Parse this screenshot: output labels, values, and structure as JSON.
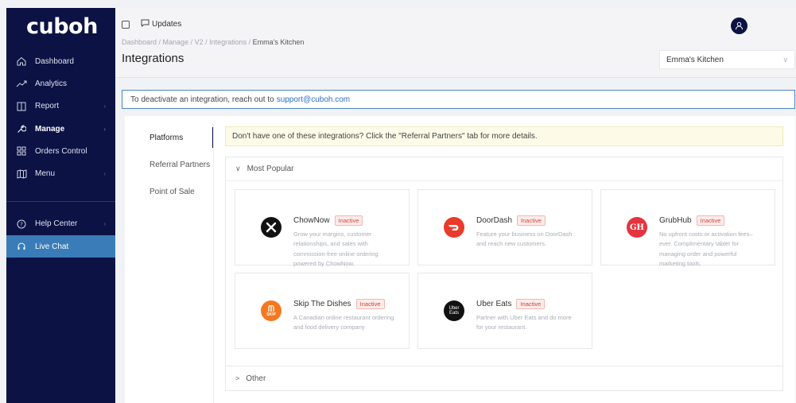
{
  "sidebar": {
    "logo": "cuboh",
    "items": [
      {
        "label": "Dashboard",
        "icon": "home-icon",
        "chevron": false
      },
      {
        "label": "Analytics",
        "icon": "trend-icon",
        "chevron": false
      },
      {
        "label": "Report",
        "icon": "report-icon",
        "chevron": true
      },
      {
        "label": "Manage",
        "icon": "wrench-icon",
        "chevron": true
      },
      {
        "label": "Orders Control",
        "icon": "grid-icon",
        "chevron": false
      },
      {
        "label": "Menu",
        "icon": "map-icon",
        "chevron": true
      }
    ],
    "help_label": "Help Center",
    "live_chat_label": "Live Chat"
  },
  "header": {
    "updates_label": "Updates",
    "breadcrumb": [
      "Dashboard",
      "Manage",
      "V2",
      "Integrations"
    ],
    "breadcrumb_current": "Emma's Kitchen",
    "title": "Integrations",
    "location_select": "Emma's Kitchen"
  },
  "notice": {
    "text": "To deactivate an integration, reach out to",
    "email": "support@cuboh.com"
  },
  "tabs": [
    "Platforms",
    "Referral Partners",
    "Point of Sale"
  ],
  "referral_notice": "Don't have one of these integrations? Click the \"Referral Partners\" tab for more details.",
  "groups": {
    "popular_label": "Most Popular",
    "other_label": "Other"
  },
  "integrations": [
    {
      "name": "ChowNow",
      "status": "Inactive",
      "desc": "Grow your margins, customer relationships, and sales with commission-free online ordering powered by ChowNow.",
      "color": "#111111"
    },
    {
      "name": "DoorDash",
      "status": "Inactive",
      "desc": "Feature your business on DoorDash and reach new customers.",
      "color": "#ea3a2a"
    },
    {
      "name": "GrubHub",
      "status": "Inactive",
      "desc": "No upfront costs or activation fees–ever. Complimentary tablet for managing order and powerful marketing tools.",
      "color": "#e5333f"
    },
    {
      "name": "Skip The Dishes",
      "status": "Inactive",
      "desc": "A Canadian online restaurant ordering and food delivery company",
      "color": "#f5781f"
    },
    {
      "name": "Uber Eats",
      "status": "Inactive",
      "desc": "Partner with Uber Eats and do more for your restaurant.",
      "color": "#111111"
    }
  ],
  "logo_text": {
    "grubhub": "GH",
    "ubereats": "Uber Eats",
    "skip": "SKIP"
  }
}
